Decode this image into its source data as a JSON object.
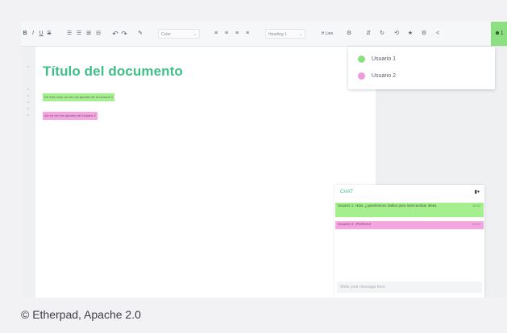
{
  "toolbar": {
    "bold": "B",
    "italic": "I",
    "underline": "U",
    "strike": "S",
    "undo": "↶",
    "redo": "↷",
    "color_select": "Color",
    "heading_select": "Heading 1",
    "font_select": "H Line",
    "users_count": "1"
  },
  "document": {
    "title": "Título del documento",
    "lines": [
      {
        "text": "De este color se ven los aportes de la Usuario 1"
      },
      {
        "text": "Así se ven los aportes del Usuario 2"
      }
    ]
  },
  "users_popup": {
    "users": [
      {
        "name": "Usuario 1",
        "color": "#8ce081"
      },
      {
        "name": "Usuario 2",
        "color": "#f19bdc"
      }
    ]
  },
  "chat": {
    "title": "CHAT",
    "messages": [
      {
        "text": "Usuario 1: Hola, ¿quisiéramos hablar para intercambiar ideas",
        "time": "10:12"
      },
      {
        "text": "Usuario 2: ¡Perfecto!",
        "time": "10:13"
      }
    ],
    "input_placeholder": "Write your message here"
  },
  "caption": "© Etherpad, Apache 2.0"
}
